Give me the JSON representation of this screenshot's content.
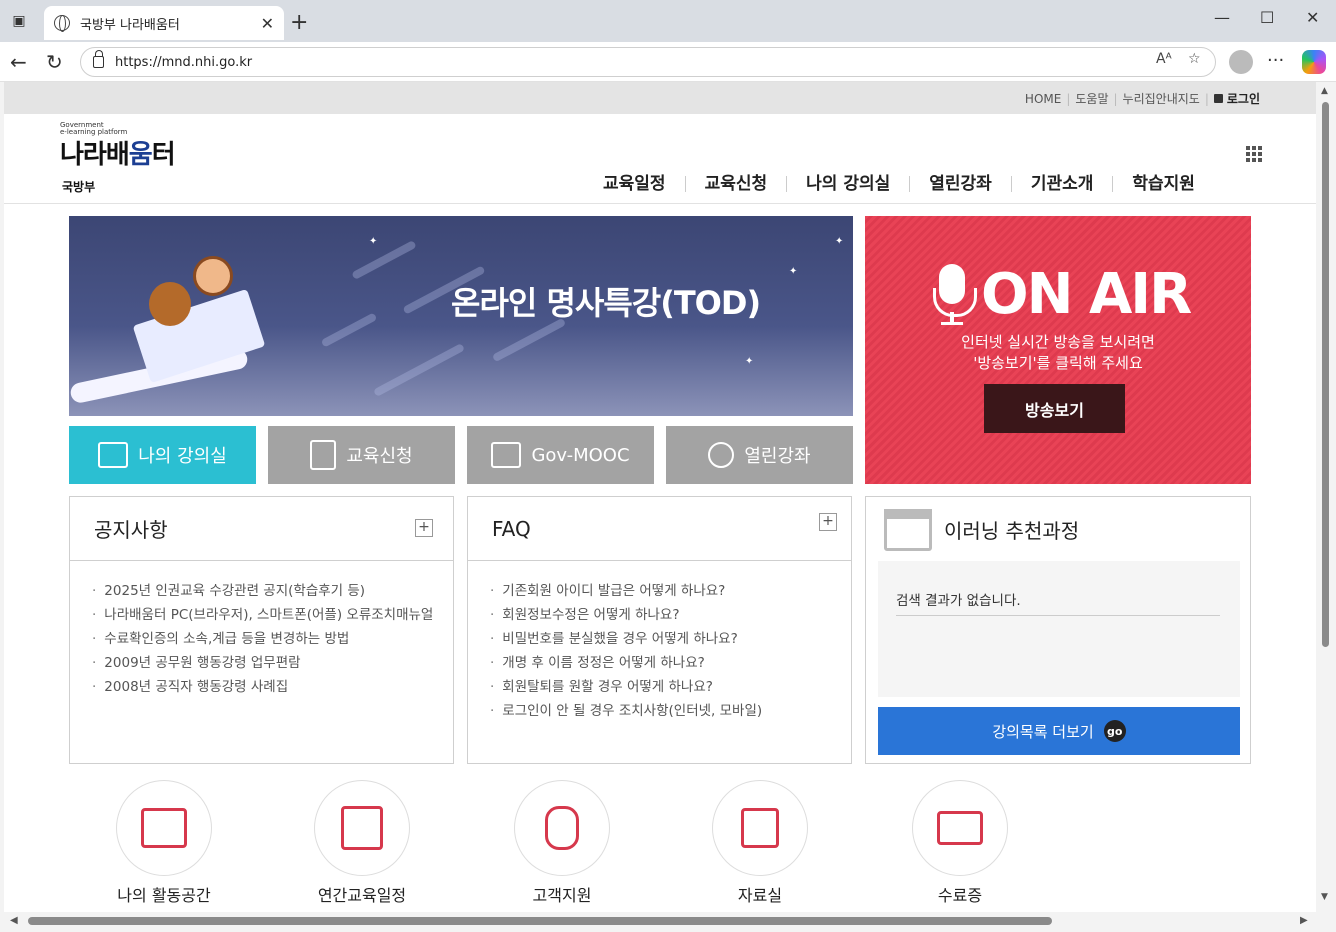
{
  "browser": {
    "tab_title": "국방부 나라배움터",
    "url": "https://mnd.nhi.go.kr"
  },
  "site": {
    "top_links": [
      "HOME",
      "도움말",
      "누리집안내지도"
    ],
    "login": "로그인",
    "logo_small_1": "Government",
    "logo_small_2": "e-learning platform",
    "logo_main_1": "나라배",
    "logo_main_2": "움",
    "logo_main_3": "터",
    "logo_sub": "국방부",
    "gnb": [
      "교육일정",
      "교육신청",
      "나의 강의실",
      "열린강좌",
      "기관소개",
      "학습지원"
    ]
  },
  "banner": {
    "title": "온라인 명사특강(TOD)"
  },
  "onair": {
    "heading": "ON AIR",
    "desc_1": "인터넷 실시간 방송을 보시려면",
    "desc_2": "'방송보기'를 클릭해 주세요",
    "button": "방송보기"
  },
  "quick": [
    "나의 강의실",
    "교육신청",
    "Gov-MOOC",
    "열린강좌"
  ],
  "notice": {
    "title": "공지사항",
    "items": [
      "2025년 인권교육 수강관련 공지(학습후기 등)",
      "나라배움터 PC(브라우저), 스마트폰(어플) 오류조치매뉴얼",
      "수료확인증의 소속,계급 등을 변경하는 방법",
      "2009년 공무원 행동강령 업무편람",
      "2008년 공직자 행동강령 사례집"
    ]
  },
  "faq": {
    "title": "FAQ",
    "items": [
      "기존회원 아이디 발급은 어떻게 하나요?",
      "회원정보수정은 어떻게 하나요?",
      "비밀번호를 분실했을 경우 어떻게 하나요?",
      "개명 후 이름 정정은 어떻게 하나요?",
      "회원탈퇴를 원할 경우 어떻게 하나요?",
      "로그인이 안 될 경우 조치사항(인터넷, 모바일)"
    ]
  },
  "recommend": {
    "title": "이러닝 추천과정",
    "result": "검색 결과가 없습니다.",
    "more": "강의목록 더보기",
    "go": "go"
  },
  "bottom": [
    "나의 활동공간",
    "연간교육일정",
    "고객지원",
    "자료실",
    "수료증"
  ],
  "colors": {
    "accent_cyan": "#2bbfd2",
    "onair_red": "#e94356",
    "more_blue": "#2a75d7",
    "icon_red": "#d6384c"
  }
}
